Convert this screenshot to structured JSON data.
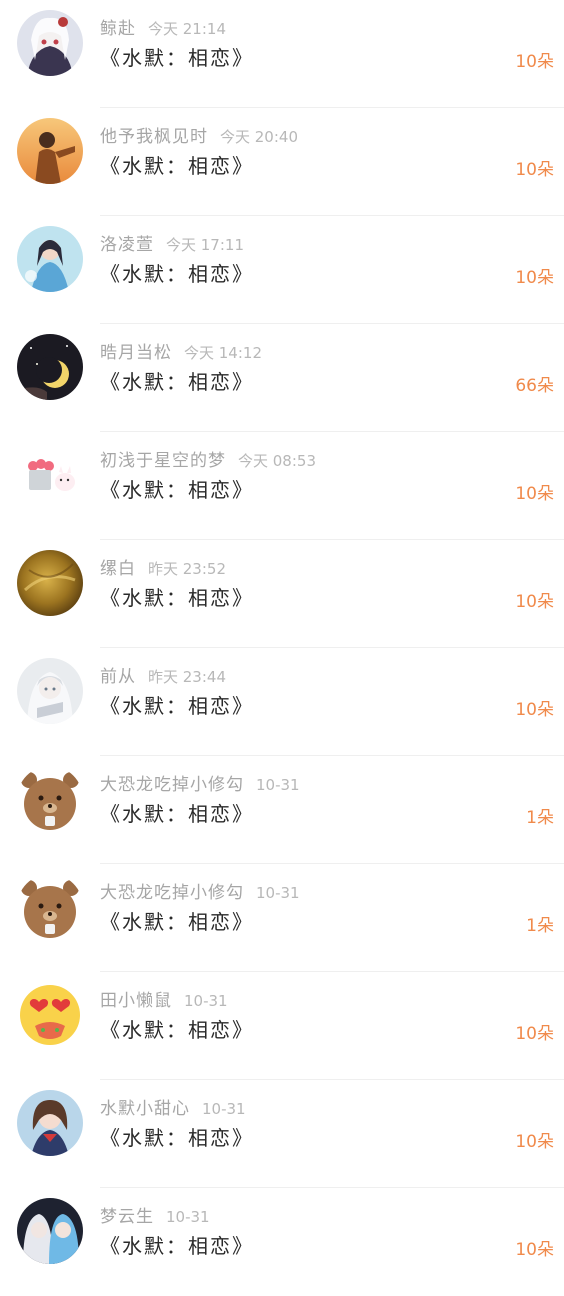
{
  "gifts": [
    {
      "name": "鲸赴",
      "time": "今天 21:14",
      "item": "《水默：相恋》",
      "count": "10朵",
      "avatar_icon": "anime-girl-white-hair-avatar"
    },
    {
      "name": "他予我枫见时",
      "time": "今天 20:40",
      "item": "《水默：相恋》",
      "count": "10朵",
      "avatar_icon": "anime-boy-sunset-avatar"
    },
    {
      "name": "洛凌萱",
      "time": "今天 17:11",
      "item": "《水默：相恋》",
      "count": "10朵",
      "avatar_icon": "anime-girl-blue-avatar"
    },
    {
      "name": "晧月当松",
      "time": "今天 14:12",
      "item": "《水默：相恋》",
      "count": "66朵",
      "avatar_icon": "crescent-moon-night-avatar"
    },
    {
      "name": "初浅于星空的梦",
      "time": "今天 08:53",
      "item": "《水默：相恋》",
      "count": "10朵",
      "avatar_icon": "flower-bucket-cartoon-avatar"
    },
    {
      "name": "缧白",
      "time": "昨天 23:52",
      "item": "《水默：相恋》",
      "count": "10朵",
      "avatar_icon": "golden-texture-avatar"
    },
    {
      "name": "前从",
      "time": "昨天 23:44",
      "item": "《水默：相恋》",
      "count": "10朵",
      "avatar_icon": "anime-white-hair-avatar"
    },
    {
      "name": "大恐龙吃掉小修勾",
      "time": "10-31",
      "item": "《水默：相恋》",
      "count": "1朵",
      "avatar_icon": "brown-bear-avatar"
    },
    {
      "name": "大恐龙吃掉小修勾",
      "time": "10-31",
      "item": "《水默：相恋》",
      "count": "1朵",
      "avatar_icon": "brown-bear-avatar"
    },
    {
      "name": "田小懒鼠",
      "time": "10-31",
      "item": "《水默：相恋》",
      "count": "10朵",
      "avatar_icon": "heart-eyes-emoji-avatar"
    },
    {
      "name": "水默小甜心",
      "time": "10-31",
      "item": "《水默：相恋》",
      "count": "10朵",
      "avatar_icon": "anime-girl-brown-hair-avatar"
    },
    {
      "name": "梦云生",
      "time": "10-31",
      "item": "《水默：相恋》",
      "count": "10朵",
      "avatar_icon": "anime-couple-avatar"
    }
  ],
  "colors": {
    "count": "#f08a4b",
    "name": "#a6a6a6",
    "item": "#2a2a2a"
  }
}
